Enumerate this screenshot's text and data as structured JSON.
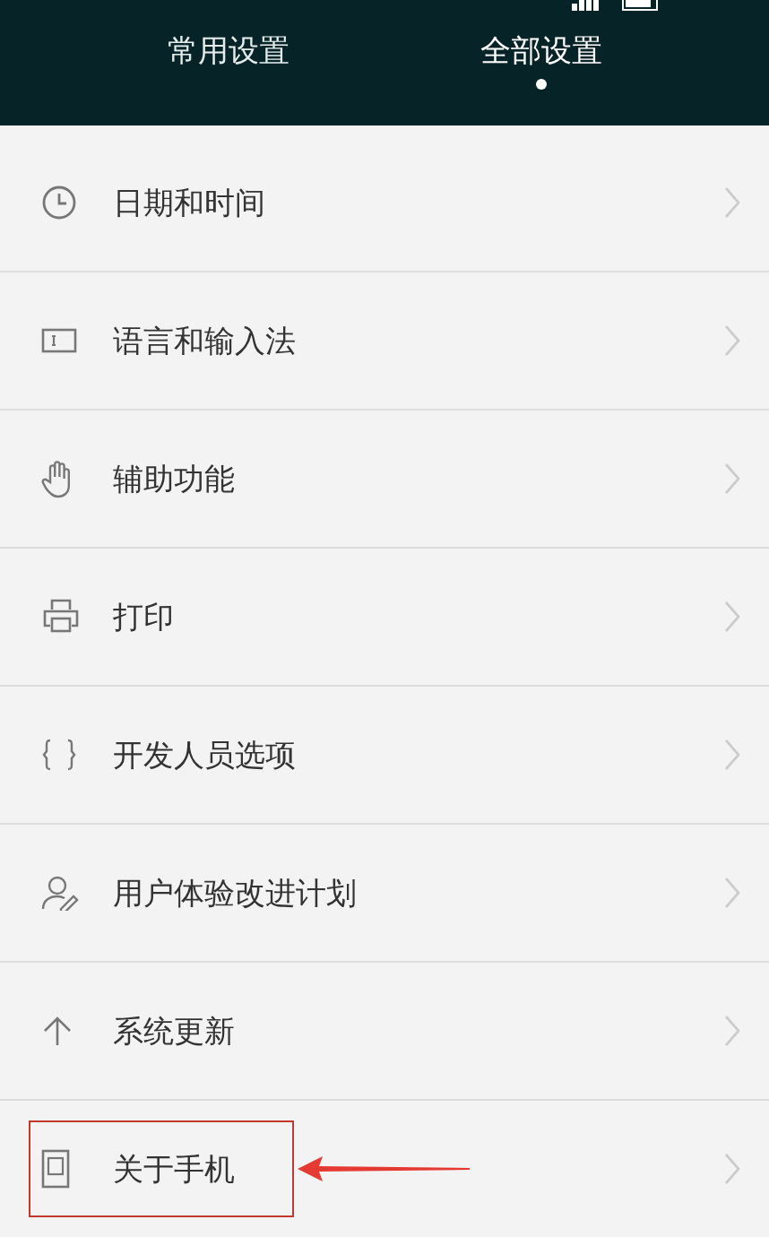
{
  "tabs": [
    {
      "label": "常用设置",
      "selected": false
    },
    {
      "label": "全部设置",
      "selected": true
    }
  ],
  "items": [
    {
      "label": "日期和时间",
      "kind": "clock",
      "highlighted": false
    },
    {
      "label": "语言和输入法",
      "kind": "keyboard",
      "highlighted": false
    },
    {
      "label": "辅助功能",
      "kind": "hand",
      "highlighted": false
    },
    {
      "label": "打印",
      "kind": "printer",
      "highlighted": false
    },
    {
      "label": "开发人员选项",
      "kind": "braces",
      "highlighted": false
    },
    {
      "label": "用户体验改进计划",
      "kind": "user",
      "highlighted": false
    },
    {
      "label": "系统更新",
      "kind": "update",
      "highlighted": false
    },
    {
      "label": "关于手机",
      "kind": "phone",
      "highlighted": true
    }
  ]
}
